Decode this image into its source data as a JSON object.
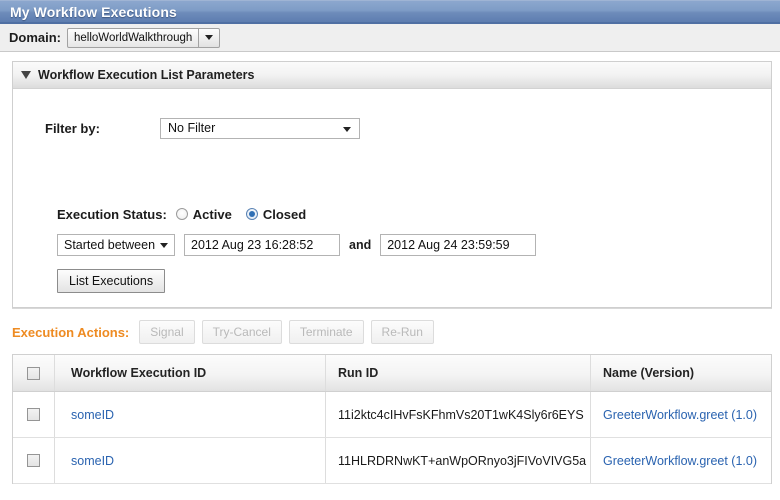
{
  "window": {
    "title": "My Workflow Executions"
  },
  "domain_bar": {
    "label": "Domain:",
    "selected": "helloWorldWalkthrough",
    "arrow_icon": "chevron-down-icon"
  },
  "panel": {
    "collapse_icon": "triangle-down-icon",
    "title": "Workflow Execution List Parameters",
    "filter": {
      "label": "Filter by:",
      "selected": "No Filter",
      "arrow_icon": "chevron-down-icon"
    },
    "execution_status": {
      "label": "Execution Status:",
      "options": [
        {
          "label": "Active",
          "checked": false
        },
        {
          "label": "Closed",
          "checked": true
        }
      ]
    },
    "date_range": {
      "mode": "Started between",
      "mode_arrow_icon": "chevron-down-icon",
      "from": "2012 Aug 23 16:28:52",
      "conjunction": "and",
      "to": "2012 Aug 24 23:59:59"
    },
    "list_button": "List Executions"
  },
  "actions": {
    "label": "Execution Actions:",
    "label_color": "#ee8b22",
    "buttons": [
      {
        "label": "Signal",
        "disabled": true
      },
      {
        "label": "Try-Cancel",
        "disabled": true
      },
      {
        "label": "Terminate",
        "disabled": true
      },
      {
        "label": "Re-Run",
        "disabled": true
      }
    ]
  },
  "table": {
    "select_all_icon": "checkbox-icon",
    "columns": [
      "Workflow Execution ID",
      "Run ID",
      "Name (Version)"
    ],
    "rows": [
      {
        "checkbox_icon": "checkbox-icon",
        "workflow_execution_id": "someID",
        "run_id": "11i2ktc4cIHvFsKFhmVs20T1wK4Sly6r6EYS",
        "name_version": "GreeterWorkflow.greet (1.0)"
      },
      {
        "checkbox_icon": "checkbox-icon",
        "workflow_execution_id": "someID",
        "run_id": "11HLRDRNwKT+anWpORnyo3jFIVoVIVG5a",
        "name_version": "GreeterWorkflow.greet (1.0)"
      }
    ]
  }
}
